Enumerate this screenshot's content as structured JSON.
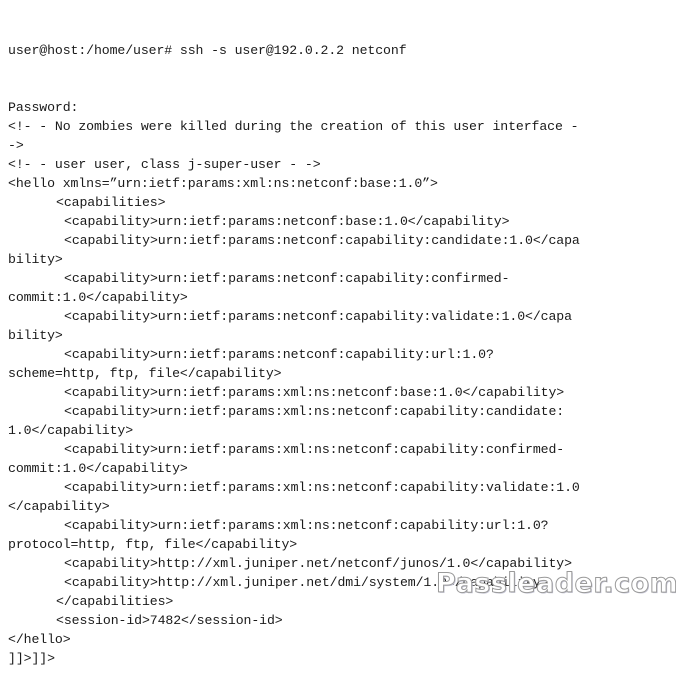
{
  "terminal": {
    "prompt": "user@host:/home/user# ssh -s user@192.0.2.2 netconf",
    "lines": [
      {
        "text": "Password:",
        "indent": 0
      },
      {
        "text": "<!- - No zombies were killed during the creation of this user interface -",
        "indent": 0
      },
      {
        "text": "->",
        "indent": 0
      },
      {
        "text": "<!- - user user, class j-super-user - ->",
        "indent": 0
      },
      {
        "text": "<hello xmlns=”urn:ietf:params:xml:ns:netconf:base:1.0”>",
        "indent": 0
      },
      {
        "text": "<capabilities>",
        "indent": 1
      },
      {
        "text": "<capability>urn:ietf:params:netconf:base:1.0</capability>",
        "indent": 2
      },
      {
        "text": "<capability>urn:ietf:params:netconf:capability:candidate:1.0</capa",
        "indent": 2
      },
      {
        "text": "bility>",
        "indent": 0
      },
      {
        "text": "<capability>urn:ietf:params:netconf:capability:confirmed-",
        "indent": 2
      },
      {
        "text": "commit:1.0</capability>",
        "indent": 0
      },
      {
        "text": "<capability>urn:ietf:params:netconf:capability:validate:1.0</capa",
        "indent": 2
      },
      {
        "text": "bility>",
        "indent": 0
      },
      {
        "text": "<capability>urn:ietf:params:netconf:capability:url:1.0?",
        "indent": 2
      },
      {
        "text": "scheme=http, ftp, file</capability>",
        "indent": 0
      },
      {
        "text": "<capability>urn:ietf:params:xml:ns:netconf:base:1.0</capability>",
        "indent": 2
      },
      {
        "text": "<capability>urn:ietf:params:xml:ns:netconf:capability:candidate:",
        "indent": 2
      },
      {
        "text": "1.0</capability>",
        "indent": 0
      },
      {
        "text": "<capability>urn:ietf:params:xml:ns:netconf:capability:confirmed-",
        "indent": 2
      },
      {
        "text": "commit:1.0</capability>",
        "indent": 0
      },
      {
        "text": "<capability>urn:ietf:params:xml:ns:netconf:capability:validate:1.0",
        "indent": 2
      },
      {
        "text": "</capability>",
        "indent": 0
      },
      {
        "text": "<capability>urn:ietf:params:xml:ns:netconf:capability:url:1.0?",
        "indent": 2
      },
      {
        "text": "protocol=http, ftp, file</capability>",
        "indent": 0
      },
      {
        "text": "<capability>http://xml.juniper.net/netconf/junos/1.0</capability>",
        "indent": 2
      },
      {
        "text": "<capability>http://xml.juniper.net/dmi/system/1.0</capability>",
        "indent": 2
      },
      {
        "text": "</capabilities>",
        "indent": 1
      },
      {
        "text": "<session-id>7482</session-id>",
        "indent": 1
      },
      {
        "text": "</hello>",
        "indent": 0
      },
      {
        "text": "]]>]]>",
        "indent": 0
      }
    ]
  },
  "watermark": {
    "text": "Passleader.com"
  }
}
